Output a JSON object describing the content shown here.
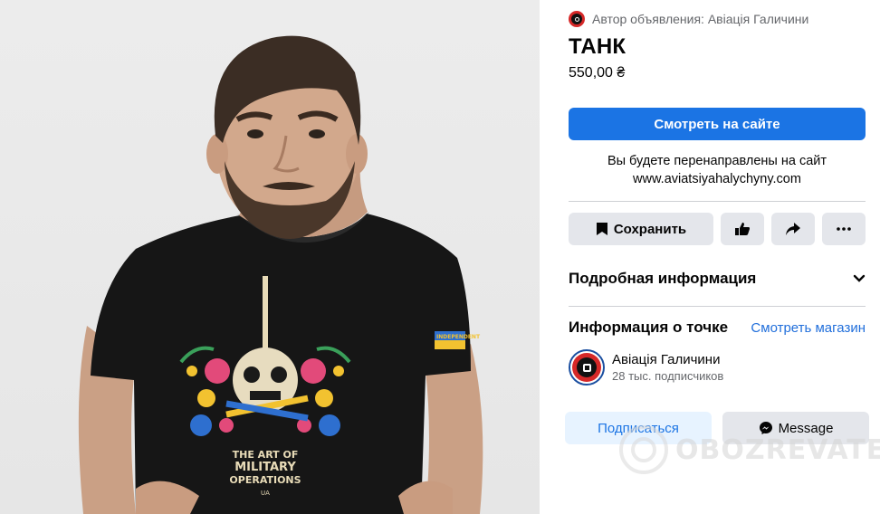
{
  "author_label": "Автор объявления: Авіація Галичини",
  "listing": {
    "title": "ТАНК",
    "price": "550,00 ₴"
  },
  "primary_button_label": "Смотреть на сайте",
  "redirect": {
    "line1": "Вы будете перенаправлены на сайт",
    "url": "www.aviatsiyahalychyny.com"
  },
  "actions": {
    "save_label": "Сохранить",
    "like_icon": "thumbs-up-icon",
    "share_icon": "share-icon",
    "more_icon": "more-horizontal-icon"
  },
  "details": {
    "title": "Подробная информация",
    "icon": "chevron-down-icon"
  },
  "location": {
    "title": "Информация о точке",
    "link_label": "Смотреть магазин"
  },
  "seller": {
    "name": "Авіація Галичини",
    "followers": "28 тыс. подписчиков"
  },
  "buttons": {
    "subscribe_label": "Подписаться",
    "message_label": "Message"
  },
  "image": {
    "print_lines": [
      "THE ART OF",
      "MILITARY",
      "OPERATIONS"
    ],
    "sleeve_text": "INDEPENDENT",
    "print_small": "UA"
  },
  "watermark": "OBOZREVATEL",
  "colors": {
    "accent": "#1b74e4",
    "button_gray": "#e4e6eb",
    "text_secondary": "#65676b",
    "link": "#216fdb"
  }
}
